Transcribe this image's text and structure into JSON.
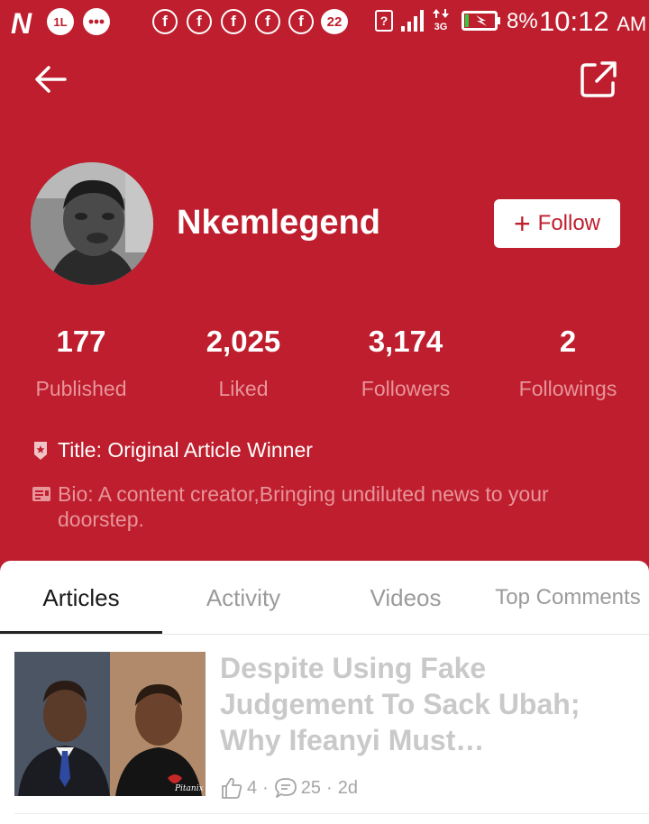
{
  "status_bar": {
    "carrier_logo": "N",
    "notif_badge": "1L",
    "facebook_glyph": "f",
    "notification_count": "22",
    "sim_unknown": "?",
    "network": "3G",
    "battery": "8%",
    "time": "10:12",
    "ampm": "AM"
  },
  "icons": {
    "back": "arrow-left-icon",
    "share": "external-share-icon",
    "title": "badge-icon",
    "bio": "id-card-icon"
  },
  "profile": {
    "username": "Nkemlegend",
    "follow_label": "Follow"
  },
  "stats": [
    {
      "value": "177",
      "label": "Published"
    },
    {
      "value": "2,025",
      "label": "Liked"
    },
    {
      "value": "3,174",
      "label": "Followers"
    },
    {
      "value": "2",
      "label": "Followings"
    }
  ],
  "title": "Title: Original Article Winner",
  "bio": "Bio: A content creator,Bringing undiluted news to your doorstep.",
  "tabs": [
    {
      "label": "Articles",
      "active": true
    },
    {
      "label": "Activity",
      "active": false
    },
    {
      "label": "Videos",
      "active": false
    },
    {
      "label": "Top Comments",
      "active": false
    }
  ],
  "articles": [
    {
      "title": "Despite Using Fake Judgement To Sack Ubah; Why Ifeanyi Must Wholeheartedly",
      "likes": "4",
      "comments": "25",
      "age": "2d",
      "watermark": "Pitanix"
    }
  ],
  "colors": {
    "header_bg": "#be1e2d",
    "muted_label": "#e8949b",
    "inactive_tab": "#9b9b9b"
  }
}
